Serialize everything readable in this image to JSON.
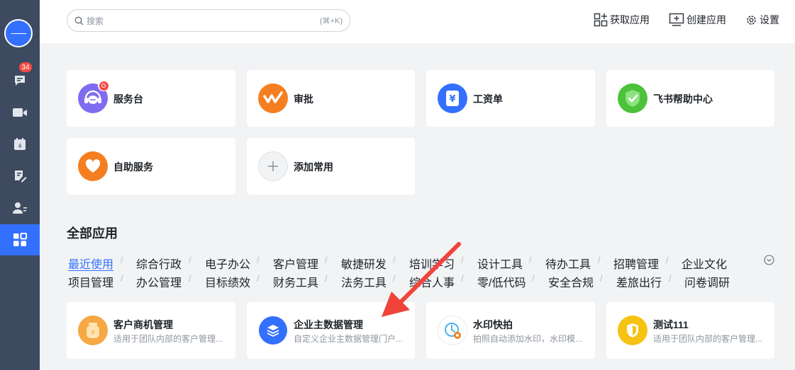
{
  "sidebar": {
    "avatar_text": "一一",
    "chat_badge": "34"
  },
  "topbar": {
    "search_placeholder": "搜索",
    "search_shortcut": "(⌘+K)",
    "get_apps": "获取应用",
    "create_app": "创建应用",
    "settings": "设置"
  },
  "favorites": [
    {
      "label": "服务台"
    },
    {
      "label": "审批"
    },
    {
      "label": "工资单"
    },
    {
      "label": "飞书帮助中心"
    },
    {
      "label": "自助服务"
    },
    {
      "label": "添加常用"
    }
  ],
  "all_apps": {
    "title": "全部应用",
    "categories_row1": [
      "最近使用",
      "综合行政",
      "电子办公",
      "客户管理",
      "敏捷研发",
      "培训学习",
      "设计工具",
      "待办工具",
      "招聘管理",
      "企业文化"
    ],
    "categories_row2": [
      "项目管理",
      "办公管理",
      "目标绩效",
      "财务工具",
      "法务工具",
      "综合人事",
      "零/低代码",
      "安全合规",
      "差旅出行",
      "问卷调研"
    ],
    "apps": [
      {
        "title": "客户商机管理",
        "desc": "适用于团队内部的客户管理..."
      },
      {
        "title": "企业主数据管理",
        "desc": "自定义企业主数据管理门户..."
      },
      {
        "title": "水印快拍",
        "desc": "拍照自动添加水印，水印模..."
      },
      {
        "title": "测试111",
        "desc": "适用于团队内部的客户管理..."
      }
    ]
  },
  "colors": {
    "accent": "#3370ff",
    "sidebar": "#3d4a5f",
    "arrow": "#f0443b"
  }
}
